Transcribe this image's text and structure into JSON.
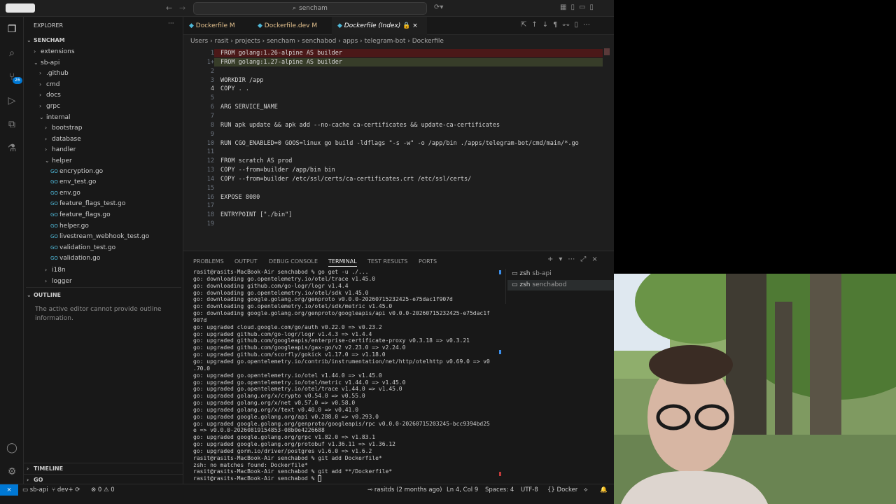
{
  "search": {
    "placeholder": "sencham"
  },
  "activity": {
    "scm_badge": "26"
  },
  "explorer": {
    "title": "EXPLORER",
    "root": "SENCHAM",
    "rows": [
      {
        "label": "extensions",
        "depth": 0,
        "kind": "folder",
        "open": false
      },
      {
        "label": "sb-api",
        "depth": 0,
        "kind": "folder",
        "open": true
      },
      {
        "label": ".github",
        "depth": 1,
        "kind": "folder",
        "open": false
      },
      {
        "label": "cmd",
        "depth": 1,
        "kind": "folder",
        "open": false
      },
      {
        "label": "docs",
        "depth": 1,
        "kind": "folder",
        "open": false
      },
      {
        "label": "grpc",
        "depth": 1,
        "kind": "folder",
        "open": false
      },
      {
        "label": "internal",
        "depth": 1,
        "kind": "folder",
        "open": true
      },
      {
        "label": "bootstrap",
        "depth": 2,
        "kind": "folder",
        "open": false
      },
      {
        "label": "database",
        "depth": 2,
        "kind": "folder",
        "open": false
      },
      {
        "label": "handler",
        "depth": 2,
        "kind": "folder",
        "open": false
      },
      {
        "label": "helper",
        "depth": 2,
        "kind": "folder",
        "open": true
      },
      {
        "label": "encryption.go",
        "depth": 3,
        "kind": "go"
      },
      {
        "label": "env_test.go",
        "depth": 3,
        "kind": "go"
      },
      {
        "label": "env.go",
        "depth": 3,
        "kind": "go"
      },
      {
        "label": "feature_flags_test.go",
        "depth": 3,
        "kind": "go"
      },
      {
        "label": "feature_flags.go",
        "depth": 3,
        "kind": "go"
      },
      {
        "label": "helper.go",
        "depth": 3,
        "kind": "go"
      },
      {
        "label": "livestream_webhook_test.go",
        "depth": 3,
        "kind": "go"
      },
      {
        "label": "validation_test.go",
        "depth": 3,
        "kind": "go"
      },
      {
        "label": "validation.go",
        "depth": 3,
        "kind": "go"
      },
      {
        "label": "i18n",
        "depth": 2,
        "kind": "folder",
        "open": false
      },
      {
        "label": "logger",
        "depth": 2,
        "kind": "folder",
        "open": false
      }
    ],
    "outline_title": "OUTLINE",
    "outline_msg": "The active editor cannot provide outline information.",
    "timeline": "TIMELINE",
    "go": "GO"
  },
  "tabs": [
    {
      "label": "Dockerfile",
      "suffix": "M"
    },
    {
      "label": "Dockerfile.dev",
      "suffix": "M"
    },
    {
      "label": "Dockerfile (Index)",
      "suffix": ""
    }
  ],
  "breadcrumb": [
    "Users",
    "rasit",
    "projects",
    "sencham",
    "senchabod",
    "apps",
    "telegram-bot",
    "Dockerfile"
  ],
  "code": [
    {
      "n": "1",
      "t": "FROM golang:1.26-alpine AS builder",
      "diff": "del"
    },
    {
      "n": "1+",
      "t": "FROM golang:1.27-alpine AS builder",
      "diff": "add"
    },
    {
      "n": "2",
      "t": ""
    },
    {
      "n": "3",
      "t": "WORKDIR /app"
    },
    {
      "n": "4",
      "t": "COPY . ."
    },
    {
      "n": "5",
      "t": ""
    },
    {
      "n": "6",
      "t": "ARG SERVICE_NAME"
    },
    {
      "n": "7",
      "t": ""
    },
    {
      "n": "8",
      "t": "RUN apk update && apk add --no-cache ca-certificates && update-ca-certificates"
    },
    {
      "n": "9",
      "t": ""
    },
    {
      "n": "10",
      "t": "RUN CGO_ENABLED=0 GOOS=linux go build -ldflags \"-s -w\" -o /app/bin ./apps/telegram-bot/cmd/main/*.go"
    },
    {
      "n": "11",
      "t": ""
    },
    {
      "n": "12",
      "t": "FROM scratch AS prod"
    },
    {
      "n": "13",
      "t": "COPY --from=builder /app/bin bin"
    },
    {
      "n": "14",
      "t": "COPY --from=builder /etc/ssl/certs/ca-certificates.crt /etc/ssl/certs/"
    },
    {
      "n": "15",
      "t": ""
    },
    {
      "n": "16",
      "t": "EXPOSE 8080"
    },
    {
      "n": "17",
      "t": ""
    },
    {
      "n": "18",
      "t": "ENTRYPOINT [\"./bin\"]"
    },
    {
      "n": "19",
      "t": ""
    }
  ],
  "panel_tabs": [
    "PROBLEMS",
    "OUTPUT",
    "DEBUG CONSOLE",
    "TERMINAL",
    "TEST RESULTS",
    "PORTS"
  ],
  "terminals": [
    {
      "label": "zsh",
      "name": "sb-api"
    },
    {
      "label": "zsh",
      "name": "senchabod"
    }
  ],
  "terminal_lines": [
    "rasit@rasits-MacBook-Air senchabod % go get -u ./...",
    "go: downloading go.opentelemetry.io/otel/trace v1.45.0",
    "go: downloading github.com/go-logr/logr v1.4.4",
    "go: downloading go.opentelemetry.io/otel/sdk v1.45.0",
    "go: downloading google.golang.org/genproto v0.0.0-20260715232425-e75dac1f907d",
    "go: downloading go.opentelemetry.io/otel/sdk/metric v1.45.0",
    "go: downloading google.golang.org/genproto/googleapis/api v0.0.0-20260715232425-e75dac1f",
    "907d",
    "go: upgraded cloud.google.com/go/auth v0.22.0 => v0.23.2",
    "go: upgraded github.com/go-logr/logr v1.4.3 => v1.4.4",
    "go: upgraded github.com/googleapis/enterprise-certificate-proxy v0.3.18 => v0.3.21",
    "go: upgraded github.com/googleapis/gax-go/v2 v2.23.0 => v2.24.0",
    "go: upgraded github.com/scorfly/gokick v1.17.0 => v1.18.0",
    "go: upgraded go.opentelemetry.io/contrib/instrumentation/net/http/otelhttp v0.69.0 => v0",
    ".70.0",
    "go: upgraded go.opentelemetry.io/otel v1.44.0 => v1.45.0",
    "go: upgraded go.opentelemetry.io/otel/metric v1.44.0 => v1.45.0",
    "go: upgraded go.opentelemetry.io/otel/trace v1.44.0 => v1.45.0",
    "go: upgraded golang.org/x/crypto v0.54.0 => v0.55.0",
    "go: upgraded golang.org/x/net v0.57.0 => v0.58.0",
    "go: upgraded golang.org/x/text v0.40.0 => v0.41.0",
    "go: upgraded google.golang.org/api v0.288.0 => v0.293.0",
    "go: upgraded google.golang.org/genproto/googleapis/rpc v0.0.0-20260715203245-bcc9394bd25",
    "e => v0.0.0-20260819154853-08b0e4226688",
    "go: upgraded google.golang.org/grpc v1.82.0 => v1.83.1",
    "go: upgraded google.golang.org/protobuf v1.36.11 => v1.36.12",
    "go: upgraded gorm.io/driver/postgres v1.6.0 => v1.6.2",
    "rasit@rasits-MacBook-Air senchabod % git add Dockerfile*",
    "zsh: no matches found: Dockerfile*",
    "rasit@rasits-MacBook-Air senchabod % git add **/Dockerfile*",
    "rasit@rasits-MacBook-Air senchabod % "
  ],
  "status": {
    "folder": "sb-api",
    "branch": "dev+",
    "errors": "0",
    "warnings": "0",
    "blame": "rasitds (2 months ago)",
    "cursor": "Ln 4, Col 9",
    "spaces": "Spaces: 4",
    "encoding": "UTF-8",
    "language": "Docker"
  },
  "colors": {
    "accent": "#0078d4",
    "modified": "#e2c08d",
    "go_icon": "#4fb8d8"
  }
}
